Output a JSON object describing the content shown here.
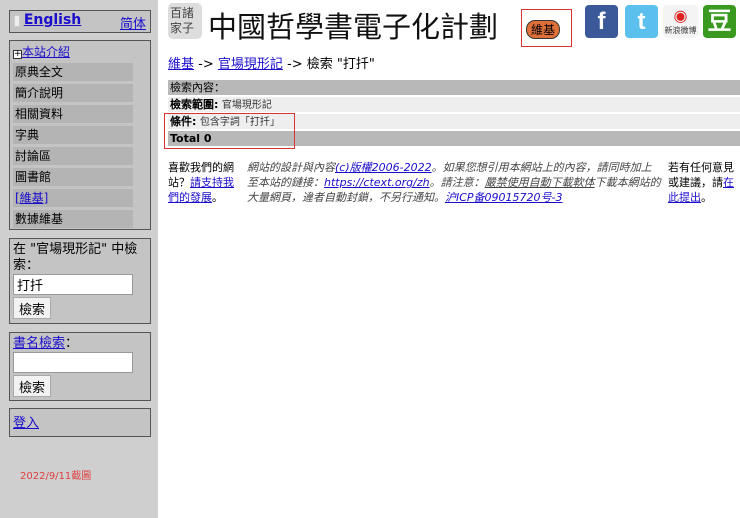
{
  "sidebar": {
    "english": "English",
    "simplified": "简体",
    "intro": "本站介紹",
    "nav": [
      "原典全文",
      "簡介說明",
      "相關資料",
      "字典",
      "討論區",
      "圖書館",
      "[維基]",
      "數據維基"
    ],
    "search_label": "在 \"官場現形記\" 中檢索：",
    "search_value": "打扦",
    "search_button": "檢索",
    "title_search_link": "書名檢索",
    "title_search_colon": "：",
    "title_search_button": "檢索",
    "login": "登入",
    "date_note": "2022/9/11截圖"
  },
  "header": {
    "logo": "百諸家子",
    "title": "中國哲學書電子化計劃",
    "badge": "維基",
    "social": [
      "facebook",
      "twitter",
      "weibo",
      "douban"
    ],
    "weibo_text": "新浪微博"
  },
  "breadcrumb": {
    "wiki": "維基",
    "sep": "->",
    "book": "官場現形記",
    "current": "檢索 \"打扦\""
  },
  "results": {
    "content_label": "檢索內容：",
    "scope_label": "檢索範圍:",
    "scope_value": "官場現形記",
    "cond_label": "條件:",
    "cond_value": "包含字詞「打扦」",
    "total": "Total 0"
  },
  "footer": {
    "left_text": "喜歡我們的網站？",
    "left_link": "請支持我們的發展",
    "left_end": "。",
    "mid_1": "網站的設計與內容",
    "mid_copy": "(c)版權2006-2022",
    "mid_2": "。如果您想引用本網站上的內容，請同時加上至本站的鏈接：",
    "mid_url": "https://ctext.org/zh",
    "mid_3": "。請注意：",
    "mid_ban": "嚴禁使用自動下載軟体",
    "mid_4": "下載本網站的大量網頁，違者自動封鎖，不另行通知。",
    "mid_icp": "沪ICP备09015720号-3",
    "right_text": "若有任何意見或建議，請",
    "right_link": "在此提出",
    "right_end": "。"
  }
}
